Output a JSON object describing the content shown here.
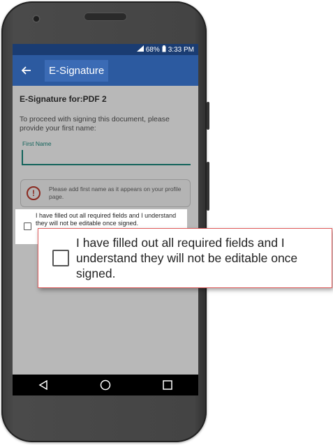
{
  "status_bar": {
    "battery": "68%",
    "time": "3:33 PM"
  },
  "app_bar": {
    "title": "E-Signature"
  },
  "form": {
    "heading": "E-Signature for:",
    "document_name": "PDF 2",
    "instructions": "To proceed with signing this document, please provide your first name:",
    "first_name_label": "First Name",
    "first_name_value": ""
  },
  "notice": {
    "text": "Please add first name as it appears on your profile page."
  },
  "confirm": {
    "label": "I have filled out all required fields and I understand they will not be editable once signed.",
    "checked": false
  },
  "colors": {
    "primary": "#2c5aa0",
    "status_bar": "#1a3c72",
    "accent": "#1a8a7e",
    "error": "#c0392b",
    "callout_border": "#e05a5a"
  },
  "icons": {
    "back": "arrow-left-icon",
    "notice": "exclamation-circle-icon",
    "nav_back": "triangle-back-icon",
    "nav_home": "circle-home-icon",
    "nav_recents": "square-recents-icon"
  }
}
